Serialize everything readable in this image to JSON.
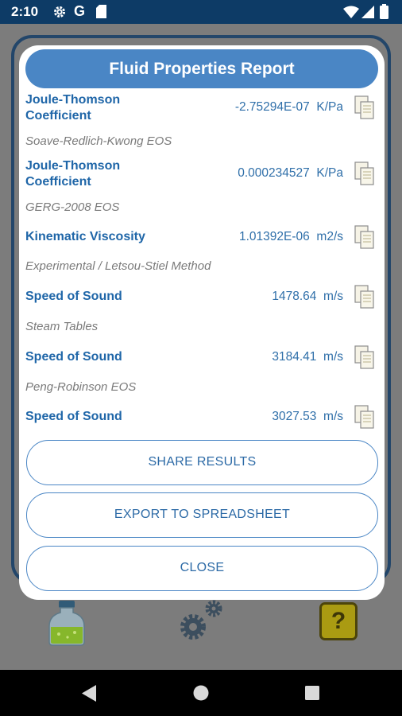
{
  "status_bar": {
    "time": "2:10",
    "app_initial": "G",
    "icons": [
      "gear-icon",
      "google-icon",
      "sd-card-icon",
      "wifi-icon",
      "signal-icon",
      "battery-icon"
    ]
  },
  "background_app": {
    "help_label": "?",
    "icons": [
      "bottle-icon",
      "gears-icon",
      "help-icon"
    ]
  },
  "dialog": {
    "title": "Fluid Properties Report",
    "results": [
      {
        "name": "Joule-Thomson Coefficient",
        "name_line1": "Joule-Thomson",
        "name_line2": "Coefficient",
        "value": "-2.75294E-07",
        "unit": "K/Pa"
      },
      {
        "method": "Soave-Redlich-Kwong EOS"
      },
      {
        "name": "Joule-Thomson Coefficient",
        "name_line1": "Joule-Thomson",
        "name_line2": "Coefficient",
        "value": "0.000234527",
        "unit": "K/Pa"
      },
      {
        "method": "GERG-2008 EOS"
      },
      {
        "name": "Kinematic Viscosity",
        "value": "1.01392E-06",
        "unit": "m2/s"
      },
      {
        "method": "Experimental / Letsou-Stiel Method"
      },
      {
        "name": "Speed of Sound",
        "value": "1478.64",
        "unit": "m/s"
      },
      {
        "method": "Steam Tables"
      },
      {
        "name": "Speed of Sound",
        "value": "3184.41",
        "unit": "m/s"
      },
      {
        "method": "Peng-Robinson EOS"
      },
      {
        "name": "Speed of Sound",
        "value": "3027.53",
        "unit": "m/s"
      }
    ],
    "buttons": {
      "share": "SHARE RESULTS",
      "export": "EXPORT TO SPREADSHEET",
      "close": "CLOSE"
    }
  },
  "colors": {
    "status_bar": "#0d3b66",
    "accent": "#4a86c5",
    "label_blue": "#1f66a8",
    "method_gray": "#7a7a7a"
  }
}
